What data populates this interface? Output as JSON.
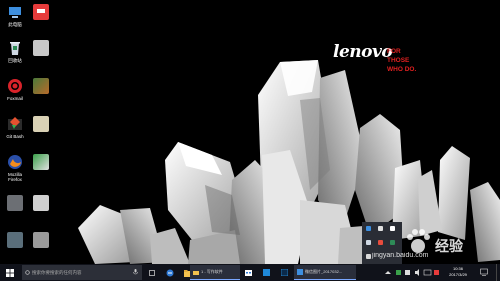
{
  "brand": {
    "logo": "lenovo",
    "tagline": [
      "FOR",
      "THOSE",
      "WHO DO."
    ]
  },
  "desktop_icons": [
    {
      "label": "此电脑",
      "icon": "computer-icon"
    },
    {
      "label": "",
      "icon": "app-red-icon"
    },
    {
      "label": "回收站",
      "icon": "recycle-bin-icon"
    },
    {
      "label": "",
      "icon": "blurred-file-icon"
    },
    {
      "label": "Foxmail",
      "icon": "foxmail-icon"
    },
    {
      "label": "",
      "icon": "blurred-file-icon"
    },
    {
      "label": "Git Bash",
      "icon": "git-bash-icon"
    },
    {
      "label": "",
      "icon": "blurred-file-icon"
    },
    {
      "label": "Mozilla Firefox",
      "icon": "firefox-icon"
    },
    {
      "label": "",
      "icon": "blurred-file-icon"
    },
    {
      "label": "",
      "icon": "blurred-file-icon"
    },
    {
      "label": "",
      "icon": "blurred-file-icon"
    },
    {
      "label": "",
      "icon": "blurred-file-icon"
    },
    {
      "label": "",
      "icon": "blurred-file-icon"
    }
  ],
  "taskbar": {
    "search_placeholder": "搜索你要搜索的任何内容",
    "apps": [
      {
        "label": "",
        "icon": "task-view-icon"
      },
      {
        "label": "",
        "icon": "edge-icon"
      },
      {
        "label": "",
        "icon": "file-explorer-icon"
      },
      {
        "label": "1 - 写作软件",
        "icon": "folder-icon"
      },
      {
        "label": "",
        "icon": "store-icon"
      },
      {
        "label": "",
        "icon": "app-icon"
      },
      {
        "label": "",
        "icon": "photoshop-icon"
      },
      {
        "label": "微信图片_2017032...",
        "icon": "photo-viewer-icon"
      }
    ],
    "clock_time": "10:36",
    "clock_date": "2017/3/29"
  },
  "watermark": {
    "text": "经验",
    "url": "jingyan.baidu.com"
  },
  "colors": {
    "taskbar": "#10121a",
    "accent": "#7aa7ff",
    "brand_red": "#e02020"
  }
}
